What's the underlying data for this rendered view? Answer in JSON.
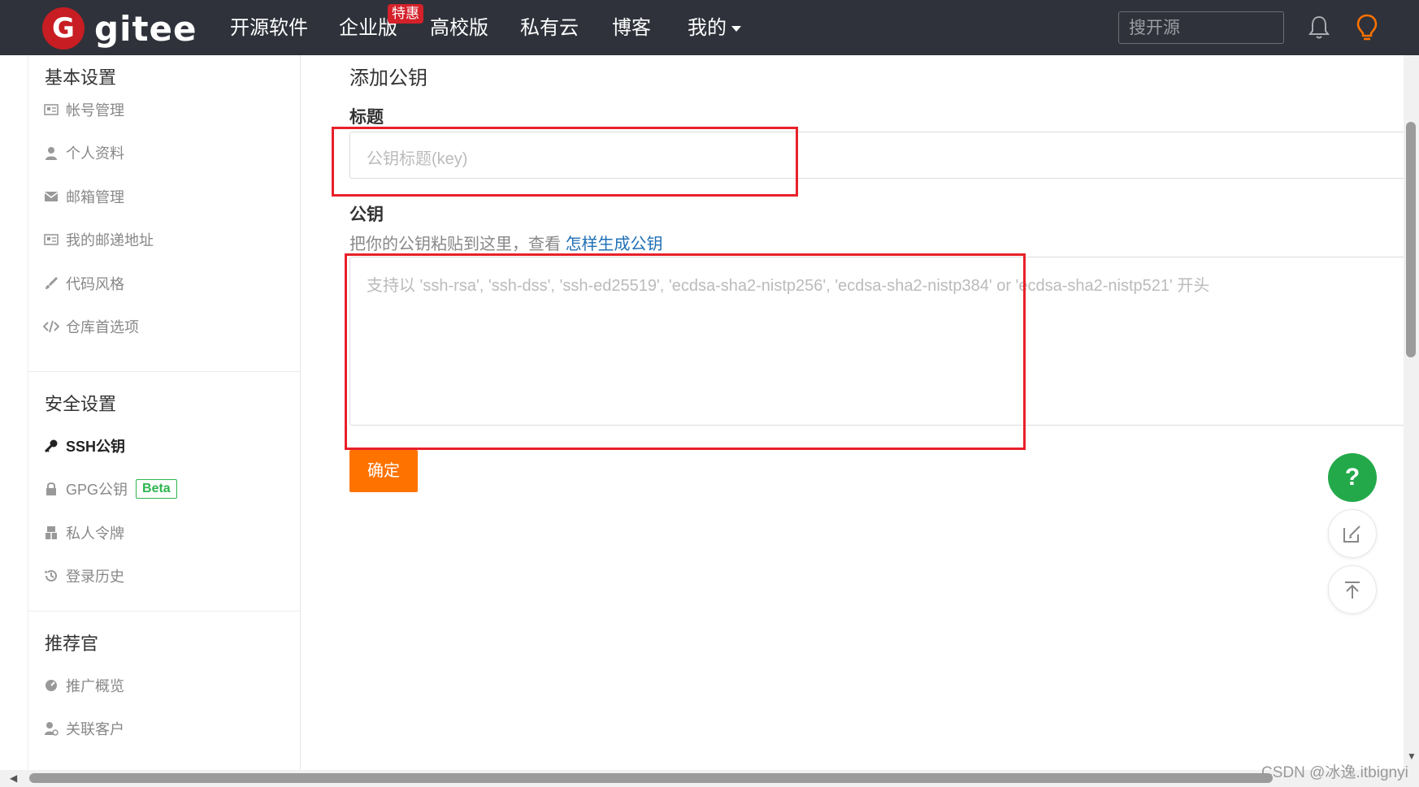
{
  "brand": {
    "logo_letter": "G",
    "name": "gitee",
    "color": "#c71d23"
  },
  "nav": {
    "items": [
      "开源软件",
      "企业版",
      "高校版",
      "私有云",
      "博客",
      "我的"
    ],
    "badge": "特惠",
    "search_placeholder": "搜开源"
  },
  "sidebar": {
    "basic": {
      "title": "基本设置",
      "items": [
        "帐号管理",
        "个人资料",
        "邮箱管理",
        "我的邮递地址",
        "代码风格",
        "仓库首选项"
      ]
    },
    "security": {
      "title": "安全设置",
      "items": [
        "SSH公钥",
        "GPG公钥",
        "私人令牌",
        "登录历史"
      ],
      "beta": "Beta"
    },
    "recommend": {
      "title": "推荐官",
      "items": [
        "推广概览",
        "关联客户"
      ]
    }
  },
  "main": {
    "heading": "添加公钥",
    "title_label": "标题",
    "title_placeholder": "公钥标题(key)",
    "key_label": "公钥",
    "hint_prefix": "把你的公钥粘贴到这里，查看",
    "hint_link": "怎样生成公钥",
    "key_placeholder": "支持以 'ssh-rsa', 'ssh-dss', 'ssh-ed25519', 'ecdsa-sha2-nistp256', 'ecdsa-sha2-nistp384' or 'ecdsa-sha2-nistp521' 开头",
    "confirm": "确定"
  },
  "fab": {
    "help": "?"
  },
  "watermark": "CSDN @冰逸.itbignyi",
  "colors": {
    "topbar": "#2f323a",
    "accent": "#fe7300",
    "link": "#1f6fb5",
    "highlight": "#e8202a",
    "help": "#23a94a"
  }
}
